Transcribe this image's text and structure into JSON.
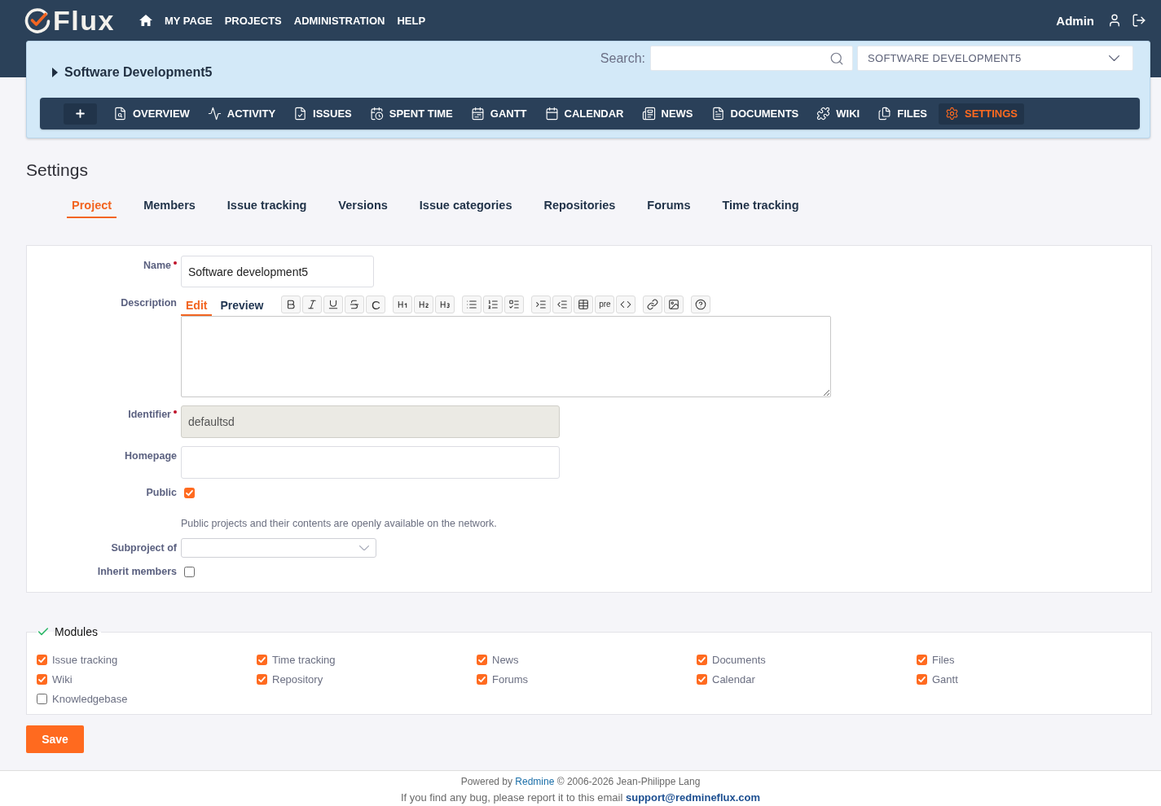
{
  "header": {
    "logo": "Flux",
    "menu": [
      "MY PAGE",
      "PROJECTS",
      "ADMINISTRATION",
      "HELP"
    ],
    "user": "Admin"
  },
  "project": {
    "title": "Software Development5",
    "search_label": "Search:",
    "project_select": "SOFTWARE DEVELOPMENT5",
    "menu": [
      {
        "label": "OVERVIEW",
        "selected": false
      },
      {
        "label": "ACTIVITY",
        "selected": false
      },
      {
        "label": "ISSUES",
        "selected": false
      },
      {
        "label": "SPENT TIME",
        "selected": false
      },
      {
        "label": "GANTT",
        "selected": false
      },
      {
        "label": "CALENDAR",
        "selected": false
      },
      {
        "label": "NEWS",
        "selected": false
      },
      {
        "label": "DOCUMENTS",
        "selected": false
      },
      {
        "label": "WIKI",
        "selected": false
      },
      {
        "label": "FILES",
        "selected": false
      },
      {
        "label": "SETTINGS",
        "selected": true
      }
    ]
  },
  "page_title": "Settings",
  "tabs": [
    {
      "label": "Project",
      "selected": true
    },
    {
      "label": "Members",
      "selected": false
    },
    {
      "label": "Issue tracking",
      "selected": false
    },
    {
      "label": "Versions",
      "selected": false
    },
    {
      "label": "Issue categories",
      "selected": false
    },
    {
      "label": "Repositories",
      "selected": false
    },
    {
      "label": "Forums",
      "selected": false
    },
    {
      "label": "Time tracking",
      "selected": false
    }
  ],
  "form": {
    "fields": [
      {
        "kind": "text",
        "label": "Name",
        "required": true,
        "disabled": false,
        "value": "Software development5"
      },
      {
        "kind": "editor",
        "label": "Description",
        "required": false,
        "tabs": [
          {
            "label": "Edit",
            "selected": true
          },
          {
            "label": "Preview",
            "selected": false
          }
        ],
        "toolbar": [
          [
            {
              "kind": "bold"
            },
            {
              "kind": "italic"
            },
            {
              "kind": "underline"
            },
            {
              "kind": "strike"
            },
            {
              "kind": "text",
              "label": "C"
            }
          ],
          [
            {
              "kind": "h1"
            },
            {
              "kind": "h2"
            },
            {
              "kind": "h3"
            }
          ],
          [
            {
              "kind": "ul"
            },
            {
              "kind": "ol"
            },
            {
              "kind": "task"
            }
          ],
          [
            {
              "kind": "indent"
            },
            {
              "kind": "outdent"
            },
            {
              "kind": "table"
            },
            {
              "kind": "text",
              "label": "pre"
            },
            {
              "kind": "code"
            }
          ],
          [
            {
              "kind": "link"
            },
            {
              "kind": "image"
            }
          ],
          [
            {
              "kind": "help"
            }
          ]
        ]
      },
      {
        "kind": "text",
        "label": "Identifier",
        "required": true,
        "disabled": true,
        "value": "defaultsd"
      },
      {
        "kind": "text",
        "label": "Homepage",
        "required": false,
        "disabled": false
      },
      {
        "kind": "checkbox",
        "label": "Public",
        "required": false,
        "checked": true,
        "hint": "Public projects and their contents are openly available on the network."
      },
      {
        "kind": "select",
        "label": "Subproject of",
        "required": false
      },
      {
        "kind": "checkbox",
        "label": "Inherit members",
        "required": false,
        "checked": false
      }
    ]
  },
  "modules": {
    "legend": "Modules",
    "items": [
      {
        "label": "Issue tracking",
        "checked": true
      },
      {
        "label": "Time tracking",
        "checked": true
      },
      {
        "label": "News",
        "checked": true
      },
      {
        "label": "Documents",
        "checked": true
      },
      {
        "label": "Files",
        "checked": true
      },
      {
        "label": "Wiki",
        "checked": true
      },
      {
        "label": "Repository",
        "checked": true
      },
      {
        "label": "Forums",
        "checked": true
      },
      {
        "label": "Calendar",
        "checked": true
      },
      {
        "label": "Gantt",
        "checked": true
      },
      {
        "label": "Knowledgebase",
        "checked": false
      }
    ]
  },
  "save_button": "Save",
  "footer": {
    "credit": {
      "before": "Powered by",
      "link": "Redmine",
      "after": "© 2006-2026 Jean-Philippe Lang"
    },
    "report": {
      "text": "If you find any bug, please report it to this email",
      "email": "support@redmineflux.com"
    }
  }
}
